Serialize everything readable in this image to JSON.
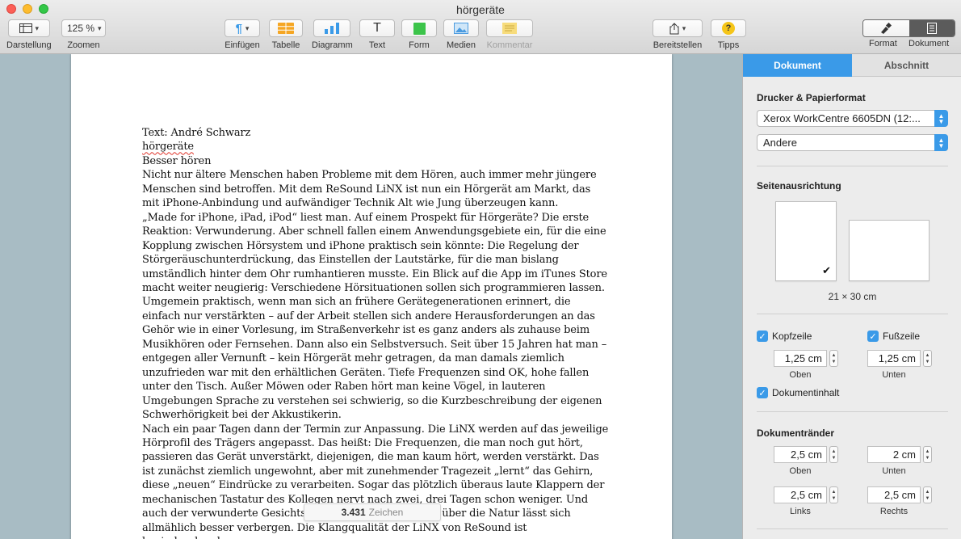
{
  "window": {
    "title": "hörgeräte"
  },
  "toolbar": {
    "view_label": "Darstellung",
    "zoom_value": "125 %",
    "zoom_label": "Zoomen",
    "insert_label": "Einfügen",
    "table_label": "Tabelle",
    "chart_label": "Diagramm",
    "text_label": "Text",
    "text_glyph": "T",
    "shape_label": "Form",
    "media_label": "Medien",
    "comment_label": "Kommentar",
    "share_label": "Bereitstellen",
    "tips_label": "Tipps",
    "tips_glyph": "?",
    "format_label": "Format",
    "document_label": "Dokument"
  },
  "document": {
    "paragraphs": [
      "Text: André Schwarz",
      "hörgeräte",
      "Besser hören",
      "Nicht nur ältere Menschen haben Probleme mit dem Hören, auch immer mehr jüngere Menschen sind betroffen. Mit dem ReSound LiNX ist nun ein Hörgerät am Markt, das mit iPhone-Anbindung und aufwändiger Technik Alt wie Jung überzeugen kann.",
      "„Made for iPhone, iPad, iPod“ liest man. Auf einem Prospekt für Hörgeräte? Die erste Reaktion: Verwunderung. Aber schnell fallen einem Anwendungsgebiete ein, für die eine Kopplung zwischen Hörsystem und iPhone praktisch sein könnte: Die Regelung der Störgeräuschunterdrückung, das Einstellen der Lautstärke, für die man bislang umständlich hinter dem Ohr rumhantieren musste. Ein Blick auf die App im iTunes Store macht weiter neugierig: Verschiedene Hörsituationen sollen sich programmieren lassen. Umgemein praktisch, wenn man sich an frühere Gerätegenerationen erinnert, die einfach nur verstärkten – auf der Arbeit stellen sich andere Herausforderungen an das Gehör wie in einer Vorlesung, im Straßenverkehr ist es ganz anders als zuhause beim Musikhören oder Fernsehen. Dann also ein Selbstversuch. Seit über 15 Jahren hat man – entgegen aller Vernunft – kein Hörgerät mehr getragen, da man damals ziemlich unzufrieden war mit den erhältlichen Geräten. Tiefe Frequenzen sind OK, hohe fallen unter den Tisch. Außer Möwen oder Raben hört man keine Vögel, in lauteren Umgebungen Sprache zu verstehen sei schwierig, so die Kurzbeschreibung der eigenen Schwerhörigkeit bei der Akkustikerin.",
      "Nach ein paar Tagen dann der Termin zur Anpassung. Die LiNX werden auf das jeweilige Hörprofil des Trägers angepasst. Das heißt: Die Frequenzen, die man noch gut hört, passieren das Gerät unverstärkt, diejenigen, die man kaum hört, werden verstärkt. Das ist zunächst ziemlich ungewohnt, aber mit zunehmender Tragezeit „lernt“ das Gehirn, diese „neuen“ Eindrücke zu verarbeiten. Sogar das plötzlich überaus laute Klappern der mechanischen Tastatur des Kollegen nervt nach zwei, drei Tagen schon weniger. Und auch der verwunderte Gesichtsausdruck, wenn man sich über die Natur lässt sich allmählich besser verbergen. Die Klangqualität der LiNX von ReSound ist beeindruckend,"
    ],
    "char_count": "3.431",
    "char_label": "Zeichen"
  },
  "inspector": {
    "tab_document": "Dokument",
    "tab_section": "Abschnitt",
    "printer_title": "Drucker & Papierformat",
    "printer_value": "Xerox WorkCentre 6605DN (12:...",
    "paper_value": "Andere",
    "orientation_title": "Seitenausrichtung",
    "paper_size": "21 × 30 cm",
    "header_label": "Kopfzeile",
    "footer_label": "Fußzeile",
    "header_value": "1,25 cm",
    "header_caption": "Oben",
    "footer_value": "1,25 cm",
    "footer_caption": "Unten",
    "body_label": "Dokumentinhalt",
    "margins_title": "Dokumentränder",
    "margin_top": "2,5 cm",
    "margin_top_caption": "Oben",
    "margin_bottom": "2 cm",
    "margin_bottom_caption": "Unten",
    "margin_left": "2,5 cm",
    "margin_left_caption": "Links",
    "margin_right": "2,5 cm",
    "margin_right_caption": "Rechts"
  },
  "colors": {
    "accent": "#3a9ae8",
    "spell_underline": "#e0352b"
  }
}
